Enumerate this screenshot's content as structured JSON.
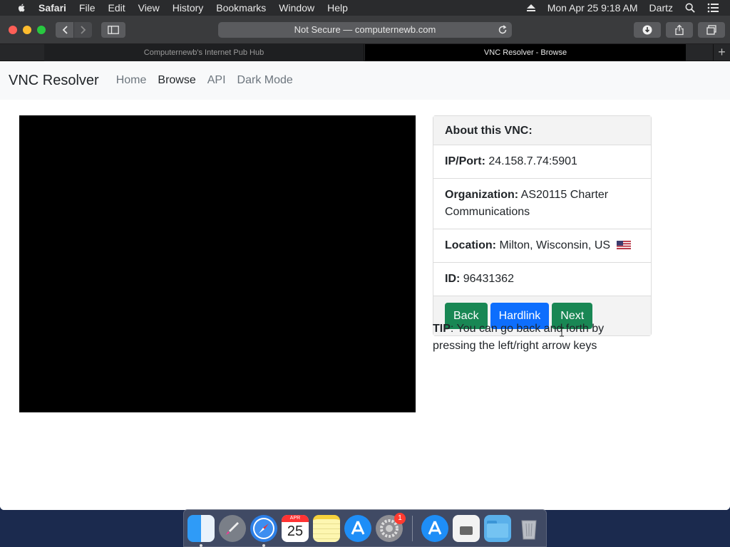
{
  "menubar": {
    "app_name": "Safari",
    "items": [
      "File",
      "Edit",
      "View",
      "History",
      "Bookmarks",
      "Window",
      "Help"
    ],
    "datetime": "Mon Apr 25  9:18 AM",
    "user": "Dartz"
  },
  "browser": {
    "address": "Not Secure — computernewb.com",
    "tabs": [
      {
        "label": "Computernewb's Internet Pub Hub"
      },
      {
        "label": "VNC Resolver - Browse"
      }
    ],
    "new_tab": "+"
  },
  "site": {
    "brand": "VNC Resolver",
    "nav": [
      "Home",
      "Browse",
      "API",
      "Dark Mode"
    ]
  },
  "vnc_info": {
    "header": "About this VNC:",
    "ip_label": "IP/Port:",
    "ip_value": "24.158.7.74:5901",
    "org_label": "Organization:",
    "org_value": "AS20115 Charter Communications",
    "location_label": "Location:",
    "location_value": "Milton, Wisconsin, US",
    "id_label": "ID:",
    "id_value": "96431362",
    "buttons": {
      "back": "Back",
      "hardlink": "Hardlink",
      "next": "Next"
    }
  },
  "tip": {
    "label": "TIP",
    "text": ": You can go back and forth by pressing the left/right arrow keys"
  },
  "dock": {
    "calendar_month": "APR",
    "calendar_day": "25",
    "settings_badge": "1"
  },
  "colors": {
    "green": "#198754",
    "blue": "#0d6efd"
  }
}
